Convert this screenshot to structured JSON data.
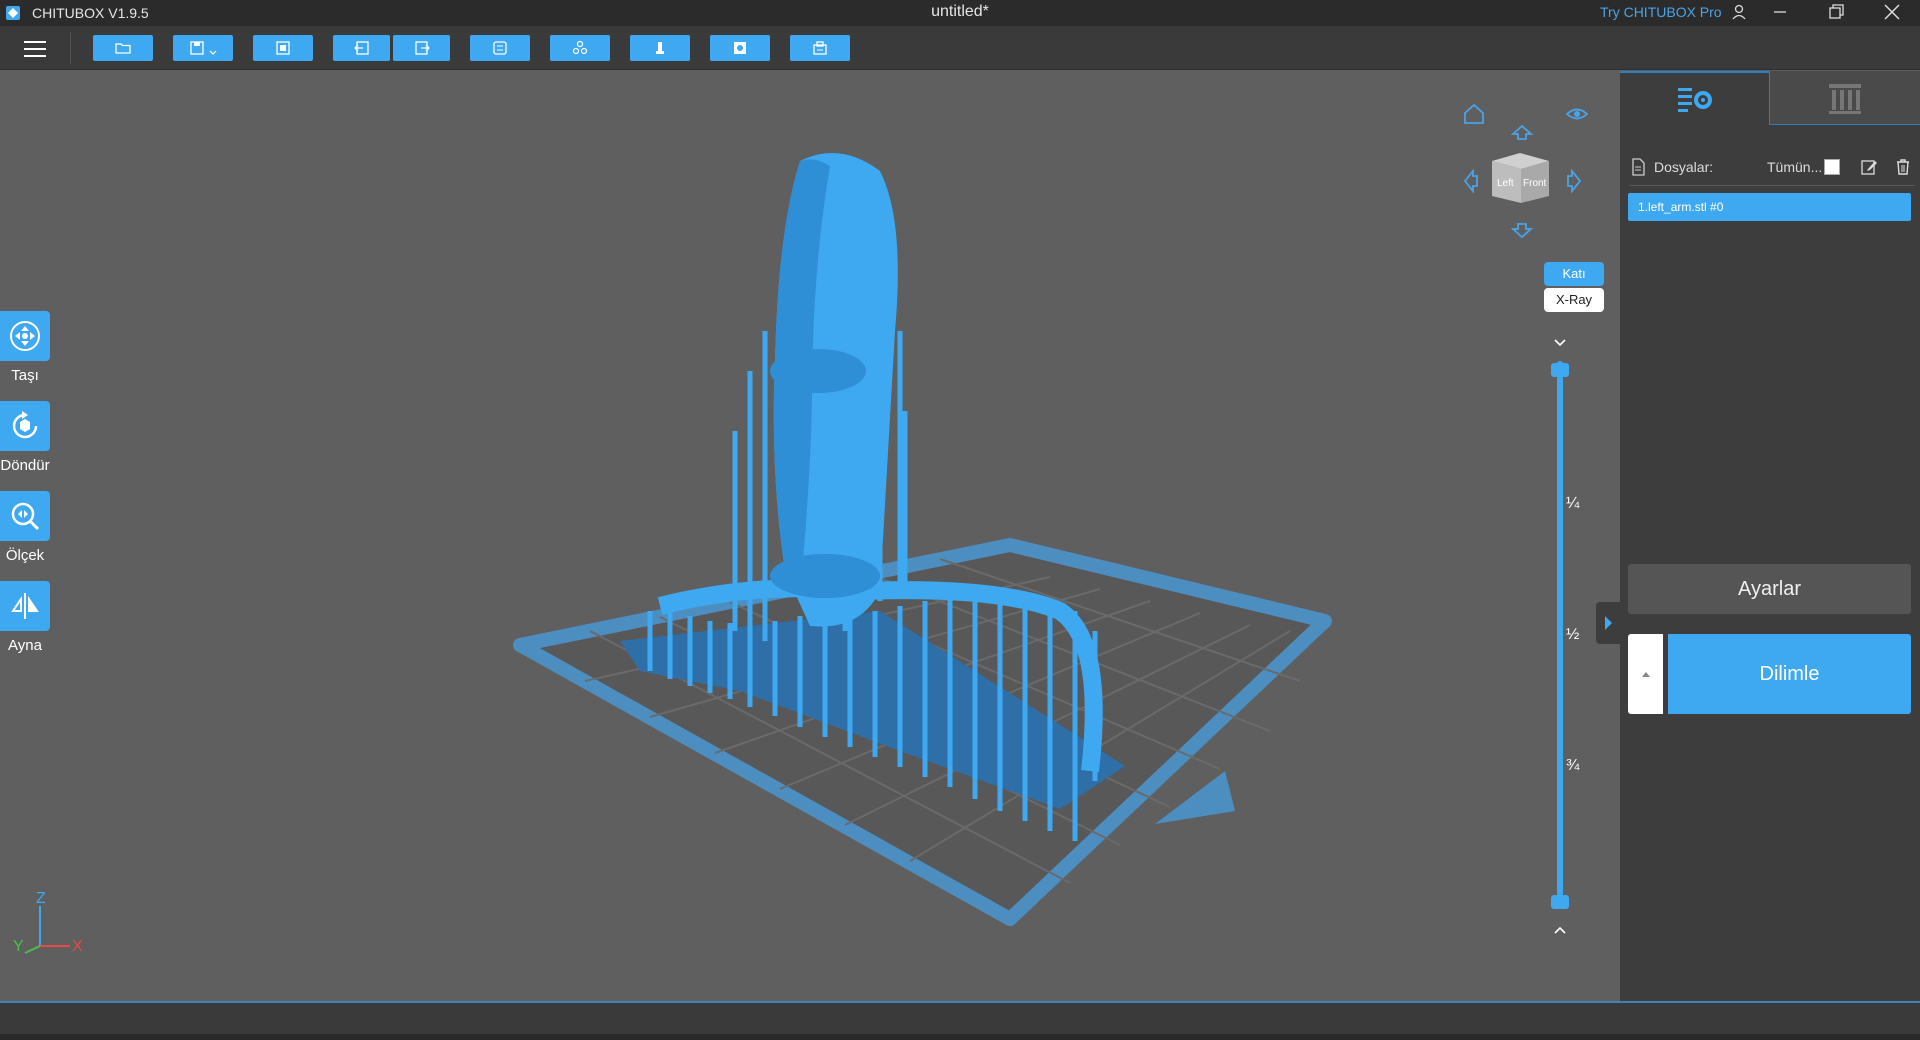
{
  "window": {
    "app_name": "CHITUBOX V1.9.5",
    "document_title": "untitled*",
    "pro_link": "Try CHITUBOX Pro",
    "icons": [
      "logo-icon",
      "user-icon",
      "minimize-icon",
      "maximize-icon",
      "close-icon"
    ]
  },
  "toolbar": {
    "buttons": [
      {
        "name": "open-file",
        "icon": "folder-icon"
      },
      {
        "name": "save-file",
        "icon": "save-icon",
        "has_dropdown": true
      },
      {
        "name": "screenshot",
        "icon": "frame-icon"
      },
      {
        "name": "import",
        "icon": "import-icon"
      },
      {
        "name": "export",
        "icon": "export-icon"
      },
      {
        "name": "layout",
        "icon": "layout-icon"
      },
      {
        "name": "arrange",
        "icon": "arrange-icon"
      },
      {
        "name": "supports",
        "icon": "support-icon"
      },
      {
        "name": "hollow",
        "icon": "hollow-icon"
      },
      {
        "name": "print",
        "icon": "printer-icon"
      }
    ]
  },
  "left_tools": [
    {
      "label": "Taşı",
      "icon": "move-icon"
    },
    {
      "label": "Döndür",
      "icon": "rotate-icon"
    },
    {
      "label": "Ölçek",
      "icon": "scale-icon"
    },
    {
      "label": "Ayna",
      "icon": "mirror-icon"
    }
  ],
  "axes": {
    "x": "X",
    "y": "Y",
    "z": "Z"
  },
  "view_cube": {
    "left_face": "Left",
    "front_face": "Front"
  },
  "view_modes": {
    "solid": "Katı",
    "xray": "X-Ray",
    "active": "Katı"
  },
  "layer_slider": {
    "marks": [
      "¼",
      "½",
      "¾"
    ],
    "lower_value": 0,
    "upper_value": 1
  },
  "right_panel": {
    "files_label": "Dosyalar:",
    "select_all_label": "Tümün...",
    "file_items": [
      "1.left_arm.stl #0"
    ],
    "settings_button": "Ayarlar",
    "slice_button": "Dilimle"
  },
  "colors": {
    "accent": "#3ea8f0",
    "viewport_bg": "#5f5f5f",
    "panel_bg": "#3d3d3d",
    "titlebar_bg": "#2b2b2b",
    "pro_link": "#4aa3e8",
    "axis_x": "#e84a4a",
    "axis_y": "#4ac04a",
    "axis_z": "#3ea8f0"
  }
}
